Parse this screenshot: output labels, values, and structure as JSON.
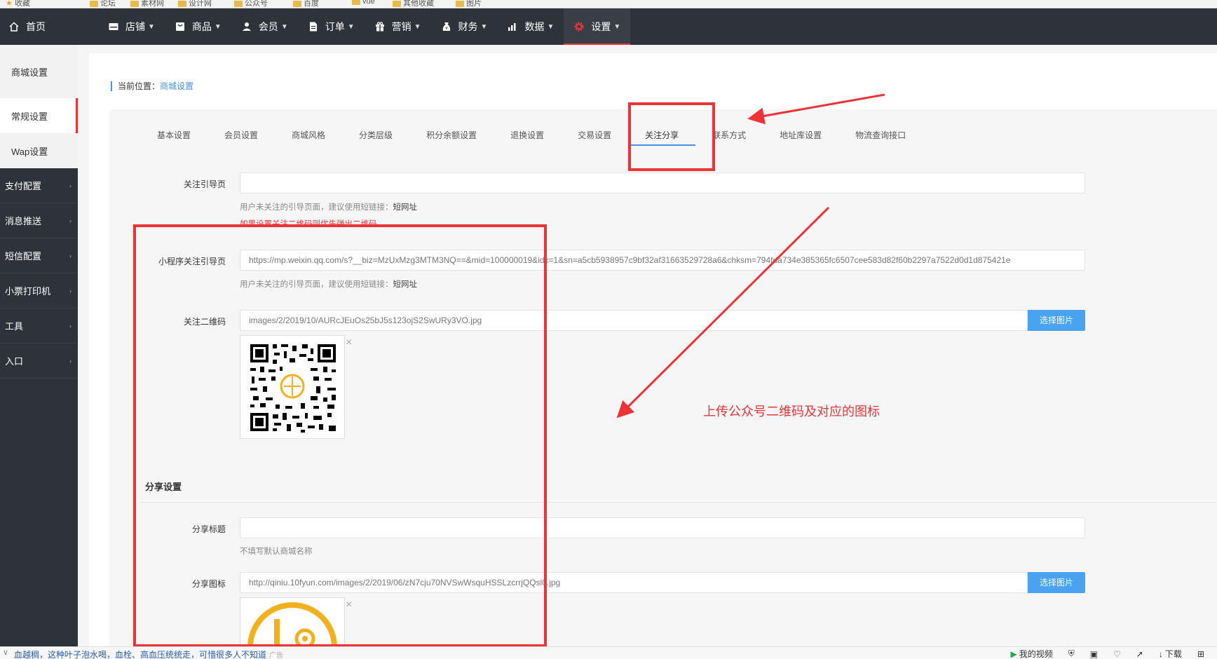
{
  "browser": {
    "bookmarks": [
      "收藏",
      "论坛",
      "素材网",
      "设计网",
      "公众号",
      "百度",
      "vue",
      "其他收藏",
      "图片"
    ]
  },
  "topnav": {
    "items": [
      {
        "label": "首页",
        "icon": "home-icon"
      },
      {
        "label": "店铺",
        "icon": "store-icon"
      },
      {
        "label": "商品",
        "icon": "goods-icon"
      },
      {
        "label": "会员",
        "icon": "user-icon"
      },
      {
        "label": "订单",
        "icon": "order-icon"
      },
      {
        "label": "营销",
        "icon": "gift-icon"
      },
      {
        "label": "财务",
        "icon": "money-icon"
      },
      {
        "label": "数据",
        "icon": "chart-icon"
      },
      {
        "label": "设置",
        "icon": "gear-icon"
      }
    ],
    "active": "设置"
  },
  "sidebar": {
    "top_items": [
      "商城设置",
      "常规设置",
      "Wap设置"
    ],
    "dark_items": [
      "支付配置",
      "消息推送",
      "短信配置",
      "小票打印机",
      "工具",
      "入口"
    ]
  },
  "breadcrumb": {
    "prefix": "当前位置：",
    "link": "商城设置"
  },
  "tabs": [
    "基本设置",
    "会员设置",
    "商城风格",
    "分类层级",
    "积分余额设置",
    "退换设置",
    "交易设置",
    "关注分享",
    "联系方式",
    "地址库设置",
    "物流查询接口"
  ],
  "form": {
    "follow_page": {
      "label": "关注引导页",
      "value": "",
      "help": "用户未关注的引导页面，建议使用短链接：",
      "help_link": "短网址",
      "help_red": "如果设置关注二维码则优先弹出二维码"
    },
    "mini_follow_page": {
      "label": "小程序关注引导页",
      "value": "https://mp.weixin.qq.com/s?__biz=MzUxMzg3MTM3NQ==&mid=100000019&idx=1&sn=a5cb5938957c9bf32af31663529728a6&chksm=794fda734e385365fc6507cee583d82f60b2297a7522d0d1d875421e",
      "help": "用户未关注的引导页面，建议使用短链接：",
      "help_link": "短网址"
    },
    "follow_qrcode": {
      "label": "关注二维码",
      "value": "images/2/2019/10/AURcJEuOs25bJ5s123ojS2SwURy3VO.jpg",
      "button": "选择图片"
    },
    "share_section_title": "分享设置",
    "share_title": {
      "label": "分享标题",
      "value": "",
      "help": "不填写默认商城名称"
    },
    "share_icon": {
      "label": "分享图标",
      "value": "http://qiniu.10fyun.com/images/2/2019/06/zN7cju70NVSwWsquHSSLzcrrjQQsl0.jpg",
      "button": "选择图片"
    }
  },
  "annotation": {
    "text": "上传公众号二维码及对应的图标",
    "color": "#e8343a"
  },
  "statusbar": {
    "news": "血越稠，这种叶子泡水喝，血栓、高血压统统走，可惜很多人不知道",
    "news_source": "广告",
    "right_items": [
      "我的视频",
      "下载"
    ]
  }
}
